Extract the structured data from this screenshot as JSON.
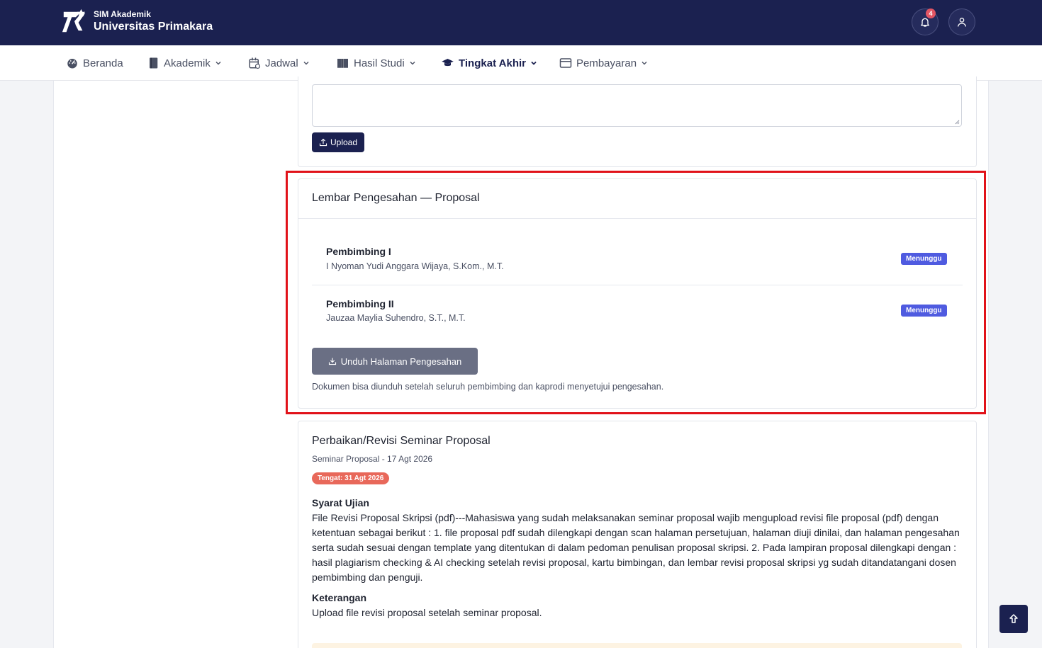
{
  "header": {
    "brand_sub": "SIM Akademik",
    "brand_title": "Universitas Primakara",
    "notification_count": "4"
  },
  "nav": {
    "items": [
      {
        "label": "Beranda",
        "icon": "dashboard-icon"
      },
      {
        "label": "Akademik",
        "icon": "book-icon"
      },
      {
        "label": "Jadwal",
        "icon": "calendar-icon"
      },
      {
        "label": "Hasil Studi",
        "icon": "book-open-icon"
      },
      {
        "label": "Tingkat Akhir",
        "icon": "graduation-cap-icon",
        "active": true
      },
      {
        "label": "Pembayaran",
        "icon": "credit-card-icon"
      }
    ]
  },
  "upload_section": {
    "textarea_value": "",
    "upload_label": "Upload"
  },
  "approval": {
    "title": "Lembar Pengesahan — Proposal",
    "supervisors": [
      {
        "role": "Pembimbing I",
        "name": "I Nyoman Yudi Anggara Wijaya, S.Kom., M.T.",
        "status": "Menunggu"
      },
      {
        "role": "Pembimbing II",
        "name": "Jauzaa Maylia Suhendro, S.T., M.T.",
        "status": "Menunggu"
      }
    ],
    "download_label": "Unduh Halaman Pengesahan",
    "note": "Dokumen bisa diunduh setelah seluruh pembimbing dan kaprodi menyetujui pengesahan."
  },
  "revision": {
    "title": "Perbaikan/Revisi Seminar Proposal",
    "subtitle": "Seminar Proposal - 17 Agt 2026",
    "deadline": "Tengat: 31 Agt 2026",
    "requirements_label": "Syarat Ujian",
    "requirements_text": "File Revisi Proposal Skripsi (pdf)---Mahasiswa yang sudah melaksanakan seminar proposal wajib mengupload revisi file proposal (pdf) dengan ketentuan sebagai berikut : 1. file proposal pdf sudah dilengkapi dengan scan halaman persetujuan, halaman diuji dinilai, dan halaman pengesahan serta sudah sesuai dengan template yang ditentukan di dalam pedoman penulisan proposal skripsi. 2. Pada lampiran proposal dilengkapi dengan : hasil plagiarism checking & AI checking setelah revisi proposal, kartu bimbingan, dan lembar revisi proposal skripsi yg sudah ditandatangani dosen pembimbing dan penguji.",
    "notes_label": "Keterangan",
    "notes_text": "Upload file revisi proposal setelah seminar proposal."
  },
  "colors": {
    "primary": "#1b2150",
    "badge_waiting": "#4f5be0",
    "deadline": "#e8685a",
    "highlight": "#e11219"
  }
}
